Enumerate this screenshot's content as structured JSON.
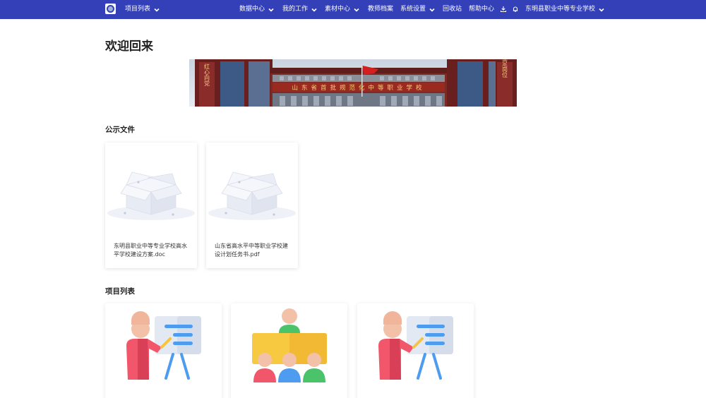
{
  "nav": {
    "project_list": "项目列表",
    "data_center": "数据中心",
    "my_work": "我的工作",
    "material_center": "素材中心",
    "teacher_files": "教师档案",
    "system_settings": "系统设置",
    "recycle_bin": "回收站",
    "help_center": "帮助中心",
    "school_name": "东明县职业中等专业学校"
  },
  "main": {
    "welcome": "欢迎回来",
    "banner_text": "山东省首批规范化中等职业学校",
    "banner_left": "红心向党",
    "banner_right": "立足岗位",
    "public_files_title": "公示文件",
    "files": [
      {
        "name": "东明县职业中等专业学校高水平学校建设方案.doc"
      },
      {
        "name": "山东省高水平中等职业学校建设计划任务书.pdf"
      }
    ],
    "projects_title": "项目列表"
  },
  "colors": {
    "nav_bg": "#3340b8",
    "nav_text": "#ffffff"
  }
}
